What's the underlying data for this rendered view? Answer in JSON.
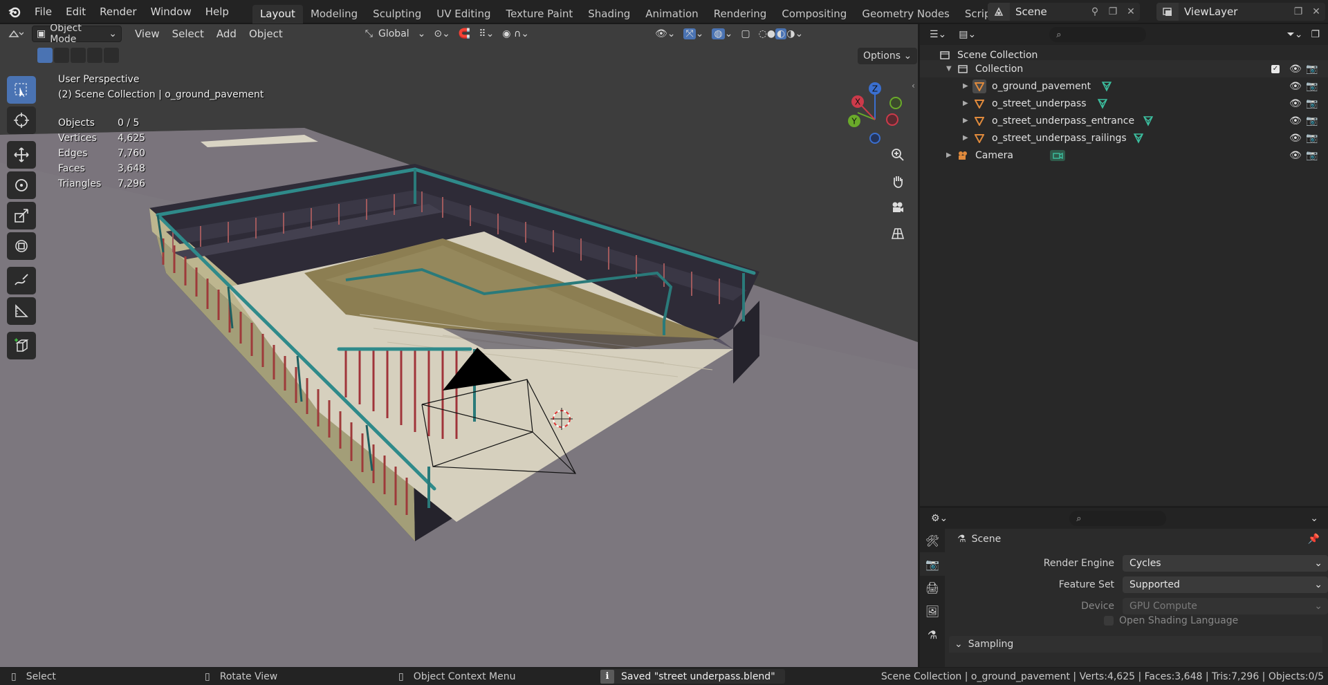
{
  "topbar": {
    "menu": [
      "File",
      "Edit",
      "Render",
      "Window",
      "Help"
    ],
    "workspaces": [
      "Layout",
      "Modeling",
      "Sculpting",
      "UV Editing",
      "Texture Paint",
      "Shading",
      "Animation",
      "Rendering",
      "Compositing",
      "Geometry Nodes",
      "Scripting"
    ],
    "active_workspace": "Layout",
    "scene_name": "Scene",
    "view_layer": "ViewLayer"
  },
  "viewport": {
    "mode": "Object Mode",
    "menu": [
      "View",
      "Select",
      "Add",
      "Object"
    ],
    "transform_orientation": "Global",
    "options_label": "Options",
    "overlay_title": "User Perspective",
    "overlay_subtitle": "(2) Scene Collection | o_ground_pavement",
    "stats": [
      {
        "k": "Objects",
        "v": "0 / 5"
      },
      {
        "k": "Vertices",
        "v": "4,625"
      },
      {
        "k": "Edges",
        "v": "7,760"
      },
      {
        "k": "Faces",
        "v": "3,648"
      },
      {
        "k": "Triangles",
        "v": "7,296"
      }
    ],
    "gizmo_axes": {
      "x": "X",
      "y": "Y",
      "z": "Z"
    }
  },
  "outliner": {
    "root": "Scene Collection",
    "collection": "Collection",
    "objects": [
      "o_ground_pavement",
      "o_street_underpass",
      "o_street_underpass_entrance",
      "o_street_underpass_railings"
    ],
    "camera": "Camera"
  },
  "properties": {
    "context": "Scene",
    "rows": [
      {
        "label": "Render Engine",
        "value": "Cycles"
      },
      {
        "label": "Feature Set",
        "value": "Supported"
      },
      {
        "label": "Device",
        "value": "GPU Compute"
      }
    ],
    "osl_label": "Open Shading Language",
    "sampling_label": "Sampling"
  },
  "status": {
    "select": "Select",
    "rotate": "Rotate View",
    "context_menu": "Object Context Menu",
    "saved_message": "Saved \"street underpass.blend\"",
    "summary": "Scene Collection | o_ground_pavement | Verts:4,625 | Faces:3,648 | Tris:7,296 | Objects:0/5"
  },
  "colors": {
    "accent": "#4a73b3",
    "object_icon": "#e08a3c",
    "mesh_data": "#3cc0a0",
    "railing_red": "#9e3a3a",
    "railing_teal": "#2a7a7a"
  }
}
